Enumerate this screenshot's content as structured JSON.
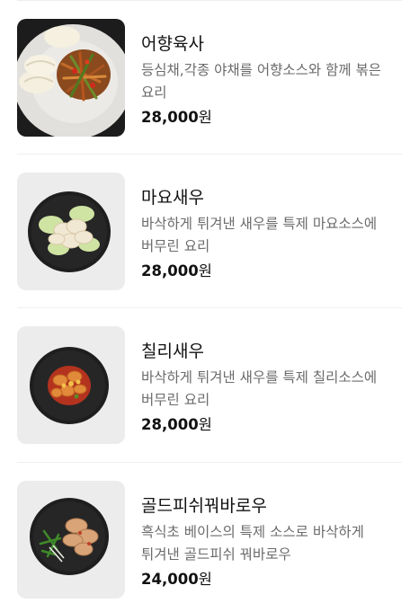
{
  "menu": {
    "items": [
      {
        "name": "어향육사",
        "description": "등심채,각종 야채를 어향소스와 함께 볶은 요리",
        "price": "28,000",
        "currency": "원",
        "image": "shredded-pork-with-buns-photo"
      },
      {
        "name": "마요새우",
        "description": "바삭하게 튀겨낸 새우를 특제 마요소스에 버무린 요리",
        "price": "28,000",
        "currency": "원",
        "image": "mayo-shrimp-photo"
      },
      {
        "name": "칠리새우",
        "description": "바삭하게 튀겨낸 새우를 특제 칠리소스에 버무린 요리",
        "price": "28,000",
        "currency": "원",
        "image": "chili-shrimp-photo"
      },
      {
        "name": "골드피쉬꿔바로우",
        "description": "흑식초 베이스의 특제 소스로 바삭하게 튀겨낸 골드피쉬 꿔바로우",
        "price": "24,000",
        "currency": "원",
        "image": "goldfish-guobaorou-photo"
      }
    ]
  }
}
